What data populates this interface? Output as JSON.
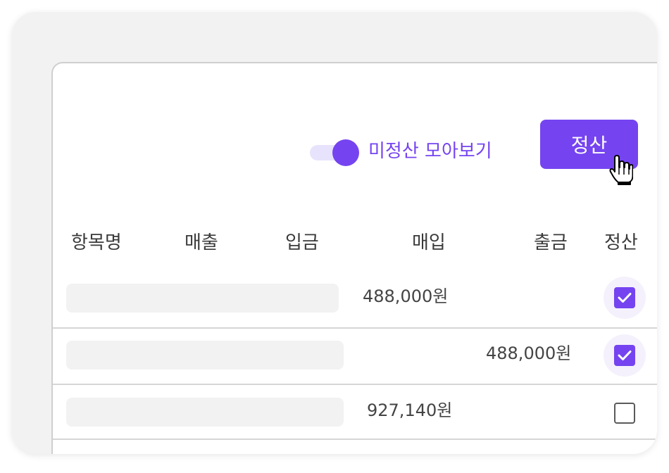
{
  "toolbar": {
    "toggle_label": "미정산 모아보기",
    "toggle_on": true,
    "settle_button": "정산"
  },
  "table": {
    "headers": [
      "항목명",
      "매출",
      "입금",
      "매입",
      "출금",
      "정산"
    ],
    "rows": [
      {
        "purchase": "488,000원",
        "withdrawal": "",
        "settled": true
      },
      {
        "purchase": "",
        "withdrawal": "488,000원",
        "settled": true
      },
      {
        "purchase": "927,140원",
        "withdrawal": "",
        "settled": false
      }
    ]
  },
  "colors": {
    "accent": "#7544f0",
    "toggle_track": "#e8e3fc",
    "background": "#f2f2f2"
  },
  "icons": {
    "cursor": "hand-pointer-icon",
    "check": "check-icon"
  }
}
